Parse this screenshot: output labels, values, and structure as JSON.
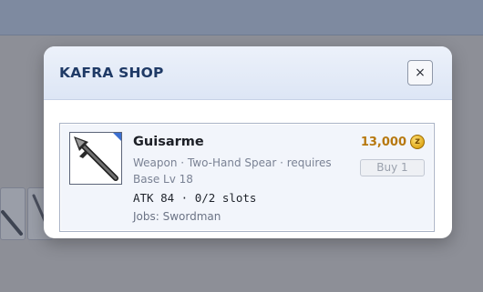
{
  "dialog": {
    "title": "KAFRA SHOP",
    "close_label": "×"
  },
  "item": {
    "name": "Guisarme",
    "description": "Weapon · Two-Hand Spear · requires Base Lv 18",
    "stats": "ATK 84 · 0/2 slots",
    "jobs": "Jobs: Swordman",
    "icon": "spear-icon",
    "price": "13,000",
    "currency_symbol": "z",
    "currency_icon": "zeny-coin-icon",
    "buy_label": "Buy 1",
    "buy_enabled": false
  },
  "colors": {
    "price": "#b7780f",
    "title": "#1f3a66",
    "icon_corner": "#3b6fd1"
  }
}
